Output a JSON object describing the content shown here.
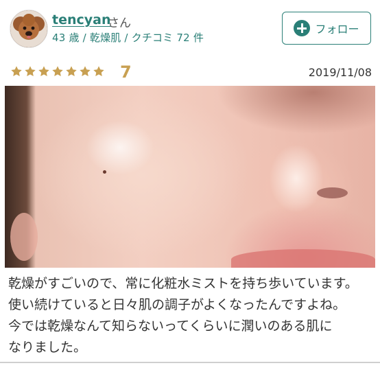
{
  "user": {
    "name": "tencyan",
    "honorific": "さん",
    "meta": "43 歳 / 乾燥肌 / クチコミ 72 件",
    "avatar_icon": "dog-avatar-icon"
  },
  "follow_button": {
    "label": "フォロー",
    "icon": "plus-circle-icon",
    "color": "#2a7f77"
  },
  "rating": {
    "stars": 7,
    "max_stars": 7,
    "score": "7",
    "star_color": "#c8a052"
  },
  "date": "2019/11/08",
  "photo": {
    "subject": "skin-closeup-photo"
  },
  "review": {
    "lines": [
      "乾燥がすごいので、常に化粧水ミストを持ち歩いています。",
      "使い続けていると日々肌の調子がよくなったんですよね。",
      "今では乾燥なんて知らないってくらいに潤いのある肌に",
      "なりました。"
    ]
  }
}
